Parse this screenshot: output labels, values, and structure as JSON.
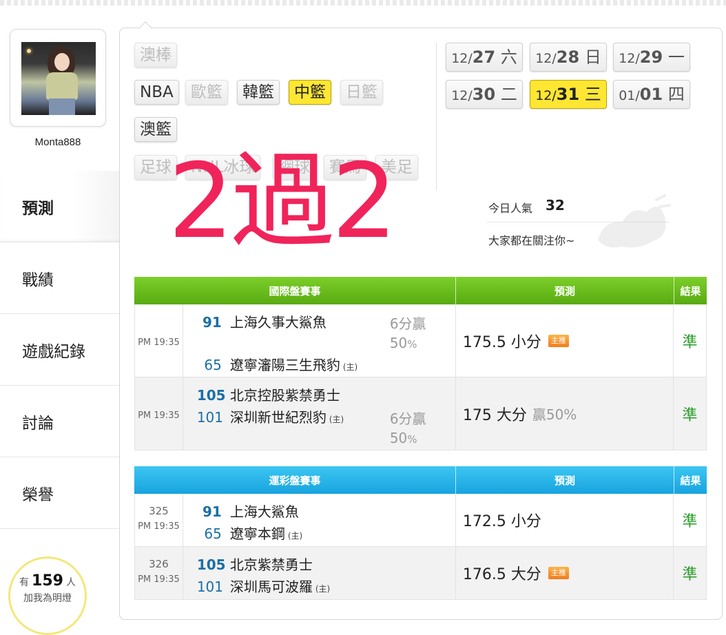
{
  "user": {
    "name": "Monta888"
  },
  "nav": [
    {
      "label": "預測",
      "active": true
    },
    {
      "label": "戰績"
    },
    {
      "label": "遊戲紀錄"
    },
    {
      "label": "討論"
    },
    {
      "label": "榮譽"
    }
  ],
  "fans": {
    "prefix": "有",
    "count": "159",
    "suffix": "人",
    "line2": "加我為明燈"
  },
  "sports": {
    "row0": [
      "澳棒"
    ],
    "row1": [
      "NBA",
      "歐籃",
      "韓籃",
      "中籃",
      "日籃"
    ],
    "row2": [
      "澳籃"
    ],
    "row3": [
      "足球",
      "NHL冰球",
      "網球",
      "賽馬",
      "美足"
    ],
    "selected": "中籃"
  },
  "dates": [
    {
      "md": "12/",
      "d": "27",
      "wd": "六"
    },
    {
      "md": "12/",
      "d": "28",
      "wd": "日"
    },
    {
      "md": "12/",
      "d": "29",
      "wd": "一"
    },
    {
      "md": "12/",
      "d": "30",
      "wd": "二"
    },
    {
      "md": "12/",
      "d": "31",
      "wd": "三",
      "selected": true
    },
    {
      "md": "01/",
      "d": "01",
      "wd": "四"
    }
  ],
  "popularity": {
    "label": "今日人氣",
    "value": "32",
    "sub": "大家都在關注你~"
  },
  "overlay": "2過2",
  "intl_table": {
    "headers": [
      "國際盤賽事",
      "預測",
      "結果"
    ],
    "rows": [
      {
        "time": "PM 19:35",
        "team1": {
          "score": "91",
          "name": "上海久事大鯊魚"
        },
        "team2": {
          "score": "65",
          "name": "遼寧瀋陽三生飛豹",
          "home": "(主)"
        },
        "handicap1": "6分贏",
        "handicap2": "50",
        "handicap2_unit": "%",
        "prediction": "175.5 小分",
        "badge": "主推",
        "result": "準"
      },
      {
        "time": "PM 19:35",
        "team1": {
          "score": "105",
          "name": "北京控股紫禁勇士"
        },
        "team2": {
          "score": "101",
          "name": "深圳新世紀烈豹",
          "home": "(主)"
        },
        "handicap1": "6分贏",
        "handicap2": "50",
        "handicap2_unit": "%",
        "prediction": "175 大分",
        "winrate": "贏50%",
        "result": "準"
      }
    ]
  },
  "lottery_table": {
    "headers": [
      "運彩盤賽事",
      "預測",
      "結果"
    ],
    "rows": [
      {
        "id": "325",
        "time": "PM 19:35",
        "team1": {
          "score": "91",
          "name": "上海大鯊魚"
        },
        "team2": {
          "score": "65",
          "name": "遼寧本鋼",
          "home": "(主)"
        },
        "prediction": "172.5 小分",
        "result": "準"
      },
      {
        "id": "326",
        "time": "PM 19:35",
        "team1": {
          "score": "105",
          "name": "北京紫禁勇士"
        },
        "team2": {
          "score": "101",
          "name": "深圳馬可波羅",
          "home": "(主)"
        },
        "prediction": "176.5 大分",
        "badge": "主推",
        "result": "準"
      }
    ]
  },
  "colors": {
    "accent": "#ffe633",
    "overlay": "#f0245a",
    "green_header": "#6cbf1e",
    "blue_header": "#25b4ea",
    "result": "#2a9b2a"
  }
}
